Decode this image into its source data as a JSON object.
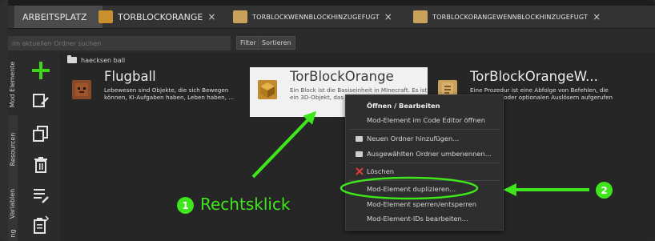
{
  "tabs": [
    {
      "label": "ARBEITSPLATZ",
      "closable": false,
      "active": true
    },
    {
      "label": "TORBLOCKORANGE",
      "closable": true,
      "icon": "mod-block-icon"
    },
    {
      "label": "TORBLOCKWENNBLOCKHINZUGEFUGT",
      "closable": true,
      "icon": "procedure-icon"
    },
    {
      "label": "TORBLOCKORANGEWENNBLOCKHINZUGEFUGT",
      "closable": true,
      "icon": "procedure-icon"
    }
  ],
  "close_glyph": "×",
  "search": {
    "placeholder": "im aktuellen Ordner suchen",
    "filter_label": "Filter",
    "sort_label": "Sortieren"
  },
  "side_tabs": [
    "Mod Elemente",
    "Resourcen",
    "Variablen",
    "ng"
  ],
  "actions": [
    "add-icon",
    "edit-icon",
    "duplicate-icon",
    "delete-icon",
    "list-edit-icon",
    "export-icon"
  ],
  "breadcrumb": {
    "folder": "haecksen ball"
  },
  "elements": [
    {
      "title": "Flugball",
      "desc": "Lebewesen sind Objekte, die sich Bewegen können, KI-Aufgaben haben, Leben haben, ..."
    },
    {
      "title": "TorBlockOrange",
      "desc": "Ein Block ist die Basiseinheit in Minecraft. Es ist ein 3D-Objekt, das platziert werden kann, ..."
    },
    {
      "title": "TorBlockOrangeW...",
      "desc": "Eine Prozedur ist eine Abfolge von Befehlen, die von Events oder optionalen Auslösern aufgerufen"
    }
  ],
  "context_menu": [
    {
      "label": "Öffnen / Bearbeiten",
      "bold": true
    },
    {
      "label": "Mod-Element im Code Editor öffnen"
    },
    {
      "label": "Neuen Ordner hinzufügen..."
    },
    {
      "label": "Ausgewählten Ordner umbenennen..."
    },
    {
      "label": "Löschen"
    },
    {
      "label": "Mod-Element duplizieren..."
    },
    {
      "label": "Mod-Element sperren/entsperren"
    },
    {
      "label": "Mod-Element-IDs bearbeiten..."
    }
  ],
  "annotations": {
    "step1_number": "1",
    "step1_label": "Rechtsklick",
    "step2_number": "2"
  },
  "colors": {
    "highlight_green": "#3fe61b",
    "delete_red": "#e03b3b",
    "selected_card_bg": "#f1f1f1"
  }
}
